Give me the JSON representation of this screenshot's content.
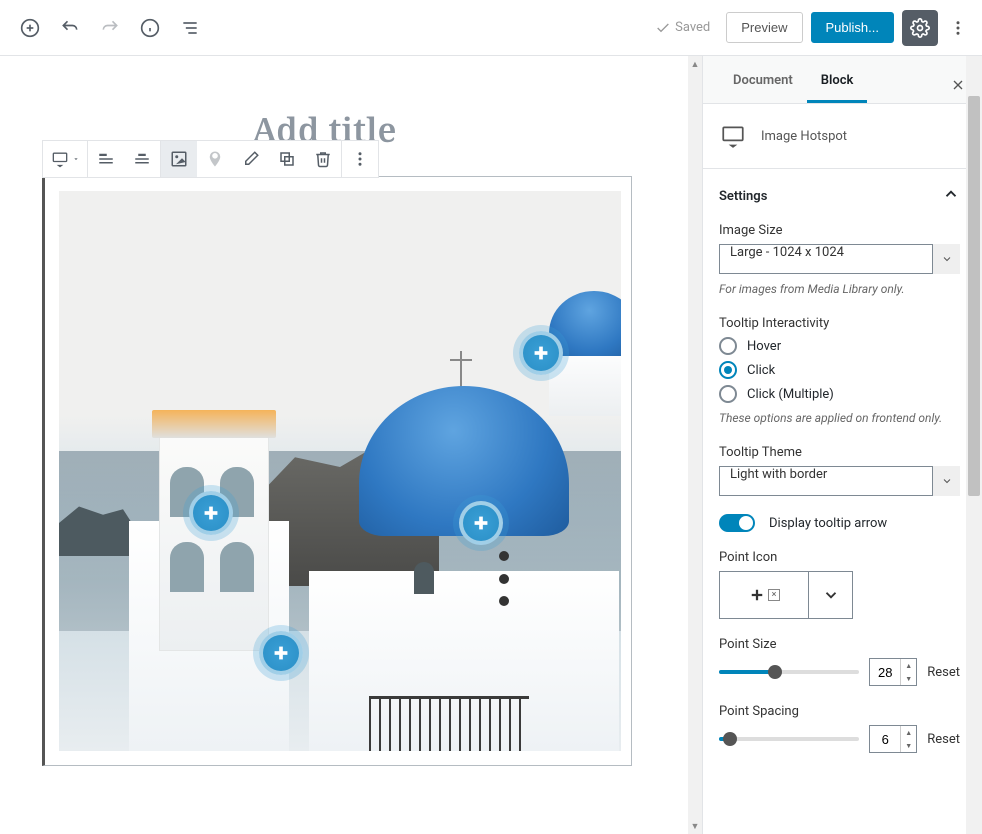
{
  "topbar": {
    "saved_label": "Saved",
    "preview_label": "Preview",
    "publish_label": "Publish..."
  },
  "editor": {
    "title_placeholder": "Add title"
  },
  "block_toolbar": {
    "icons": [
      "block-type",
      "align-left",
      "align-center",
      "align-wide",
      "media",
      "hotspot-marker",
      "edit",
      "duplicate",
      "trash",
      "more"
    ]
  },
  "sidebar": {
    "tabs": {
      "document": "Document",
      "block": "Block"
    },
    "block_name": "Image Hotspot",
    "panel_title": "Settings",
    "image_size": {
      "label": "Image Size",
      "value": "Large - 1024 x 1024",
      "hint": "For images from Media Library only."
    },
    "tooltip_interactivity": {
      "label": "Tooltip Interactivity",
      "options": [
        "Hover",
        "Click",
        "Click (Multiple)"
      ],
      "selected": "Click",
      "hint": "These options are applied on frontend only."
    },
    "tooltip_theme": {
      "label": "Tooltip Theme",
      "value": "Light with border"
    },
    "display_arrow": {
      "label": "Display tooltip arrow",
      "checked": true
    },
    "point_icon": {
      "label": "Point Icon"
    },
    "point_size": {
      "label": "Point Size",
      "value": 28,
      "min": 0,
      "max": 100,
      "reset": "Reset"
    },
    "point_spacing": {
      "label": "Point Spacing",
      "value": 6,
      "min": 0,
      "max": 100,
      "reset": "Reset"
    }
  },
  "colors": {
    "primary": "#0085ba",
    "hotspot": "#3a9fd6"
  }
}
